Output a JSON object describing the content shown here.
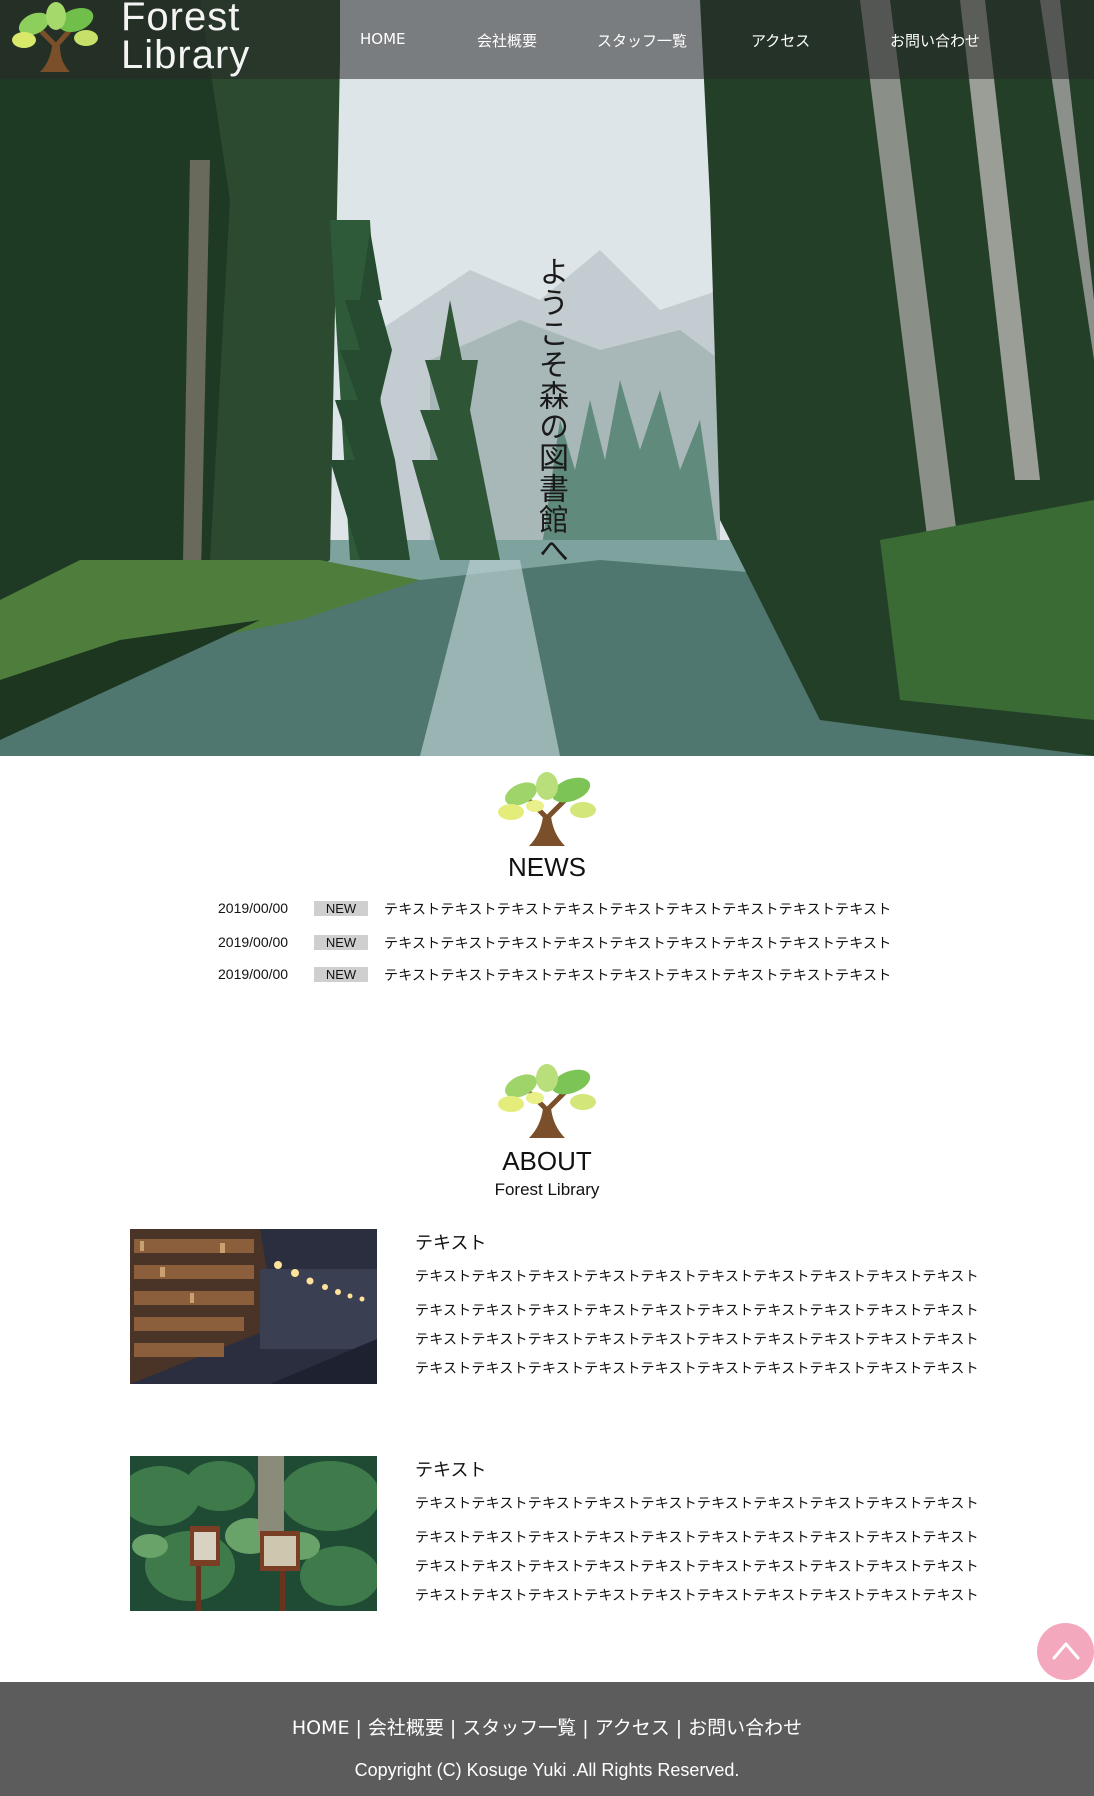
{
  "brand": {
    "line1": "Forest",
    "line2": "Library"
  },
  "nav": {
    "items": [
      "HOME",
      "会社概要",
      "スタッフ一覧",
      "アクセス",
      "お問い合わせ"
    ]
  },
  "hero": {
    "copy": "ようこそ森の図書館へ"
  },
  "news": {
    "title": "NEWS",
    "items": [
      {
        "date": "2019/00/00",
        "badge": "NEW",
        "text": "テキストテキストテキストテキストテキストテキストテキストテキストテキスト"
      },
      {
        "date": "2019/00/00",
        "badge": "NEW",
        "text": "テキストテキストテキストテキストテキストテキストテキストテキストテキスト"
      },
      {
        "date": "2019/00/00",
        "badge": "NEW",
        "text": "テキストテキストテキストテキストテキストテキストテキストテキストテキスト"
      }
    ]
  },
  "about": {
    "title": "ABOUT",
    "subtitle": "Forest Library",
    "blocks": [
      {
        "heading": "テキスト",
        "lines": [
          "テキストテキストテキストテキストテキストテキストテキストテキストテキストテキスト",
          "テキストテキストテキストテキストテキストテキストテキストテキストテキストテキスト",
          "テキストテキストテキストテキストテキストテキストテキストテキストテキストテキスト",
          "テキストテキストテキストテキストテキストテキストテキストテキストテキストテキスト"
        ]
      },
      {
        "heading": "テキスト",
        "lines": [
          "テキストテキストテキストテキストテキストテキストテキストテキストテキストテキスト",
          "テキストテキストテキストテキストテキストテキストテキストテキストテキストテキスト",
          "テキストテキストテキストテキストテキストテキストテキストテキストテキストテキスト",
          "テキストテキストテキストテキストテキストテキストテキストテキストテキストテキスト"
        ]
      }
    ]
  },
  "footer": {
    "nav": [
      "HOME",
      "会社概要",
      "スタッフ一覧",
      "アクセス",
      "お問い合わせ"
    ],
    "separator": "|",
    "copyright": "Copyright (C) Kosuge Yuki .All Rights Reserved."
  },
  "icons": {
    "emblem": "tree-icon",
    "to_top": "chevron-up-icon"
  },
  "colors": {
    "header_bg": "#282828",
    "footer_bg": "#5c5c5c",
    "badge_bg": "#cfcfcf",
    "to_top_bg": "#f4a8bd",
    "leaf_green": "#8ccf5c",
    "leaf_yellow": "#d8e86a",
    "trunk": "#7a4f2a"
  }
}
